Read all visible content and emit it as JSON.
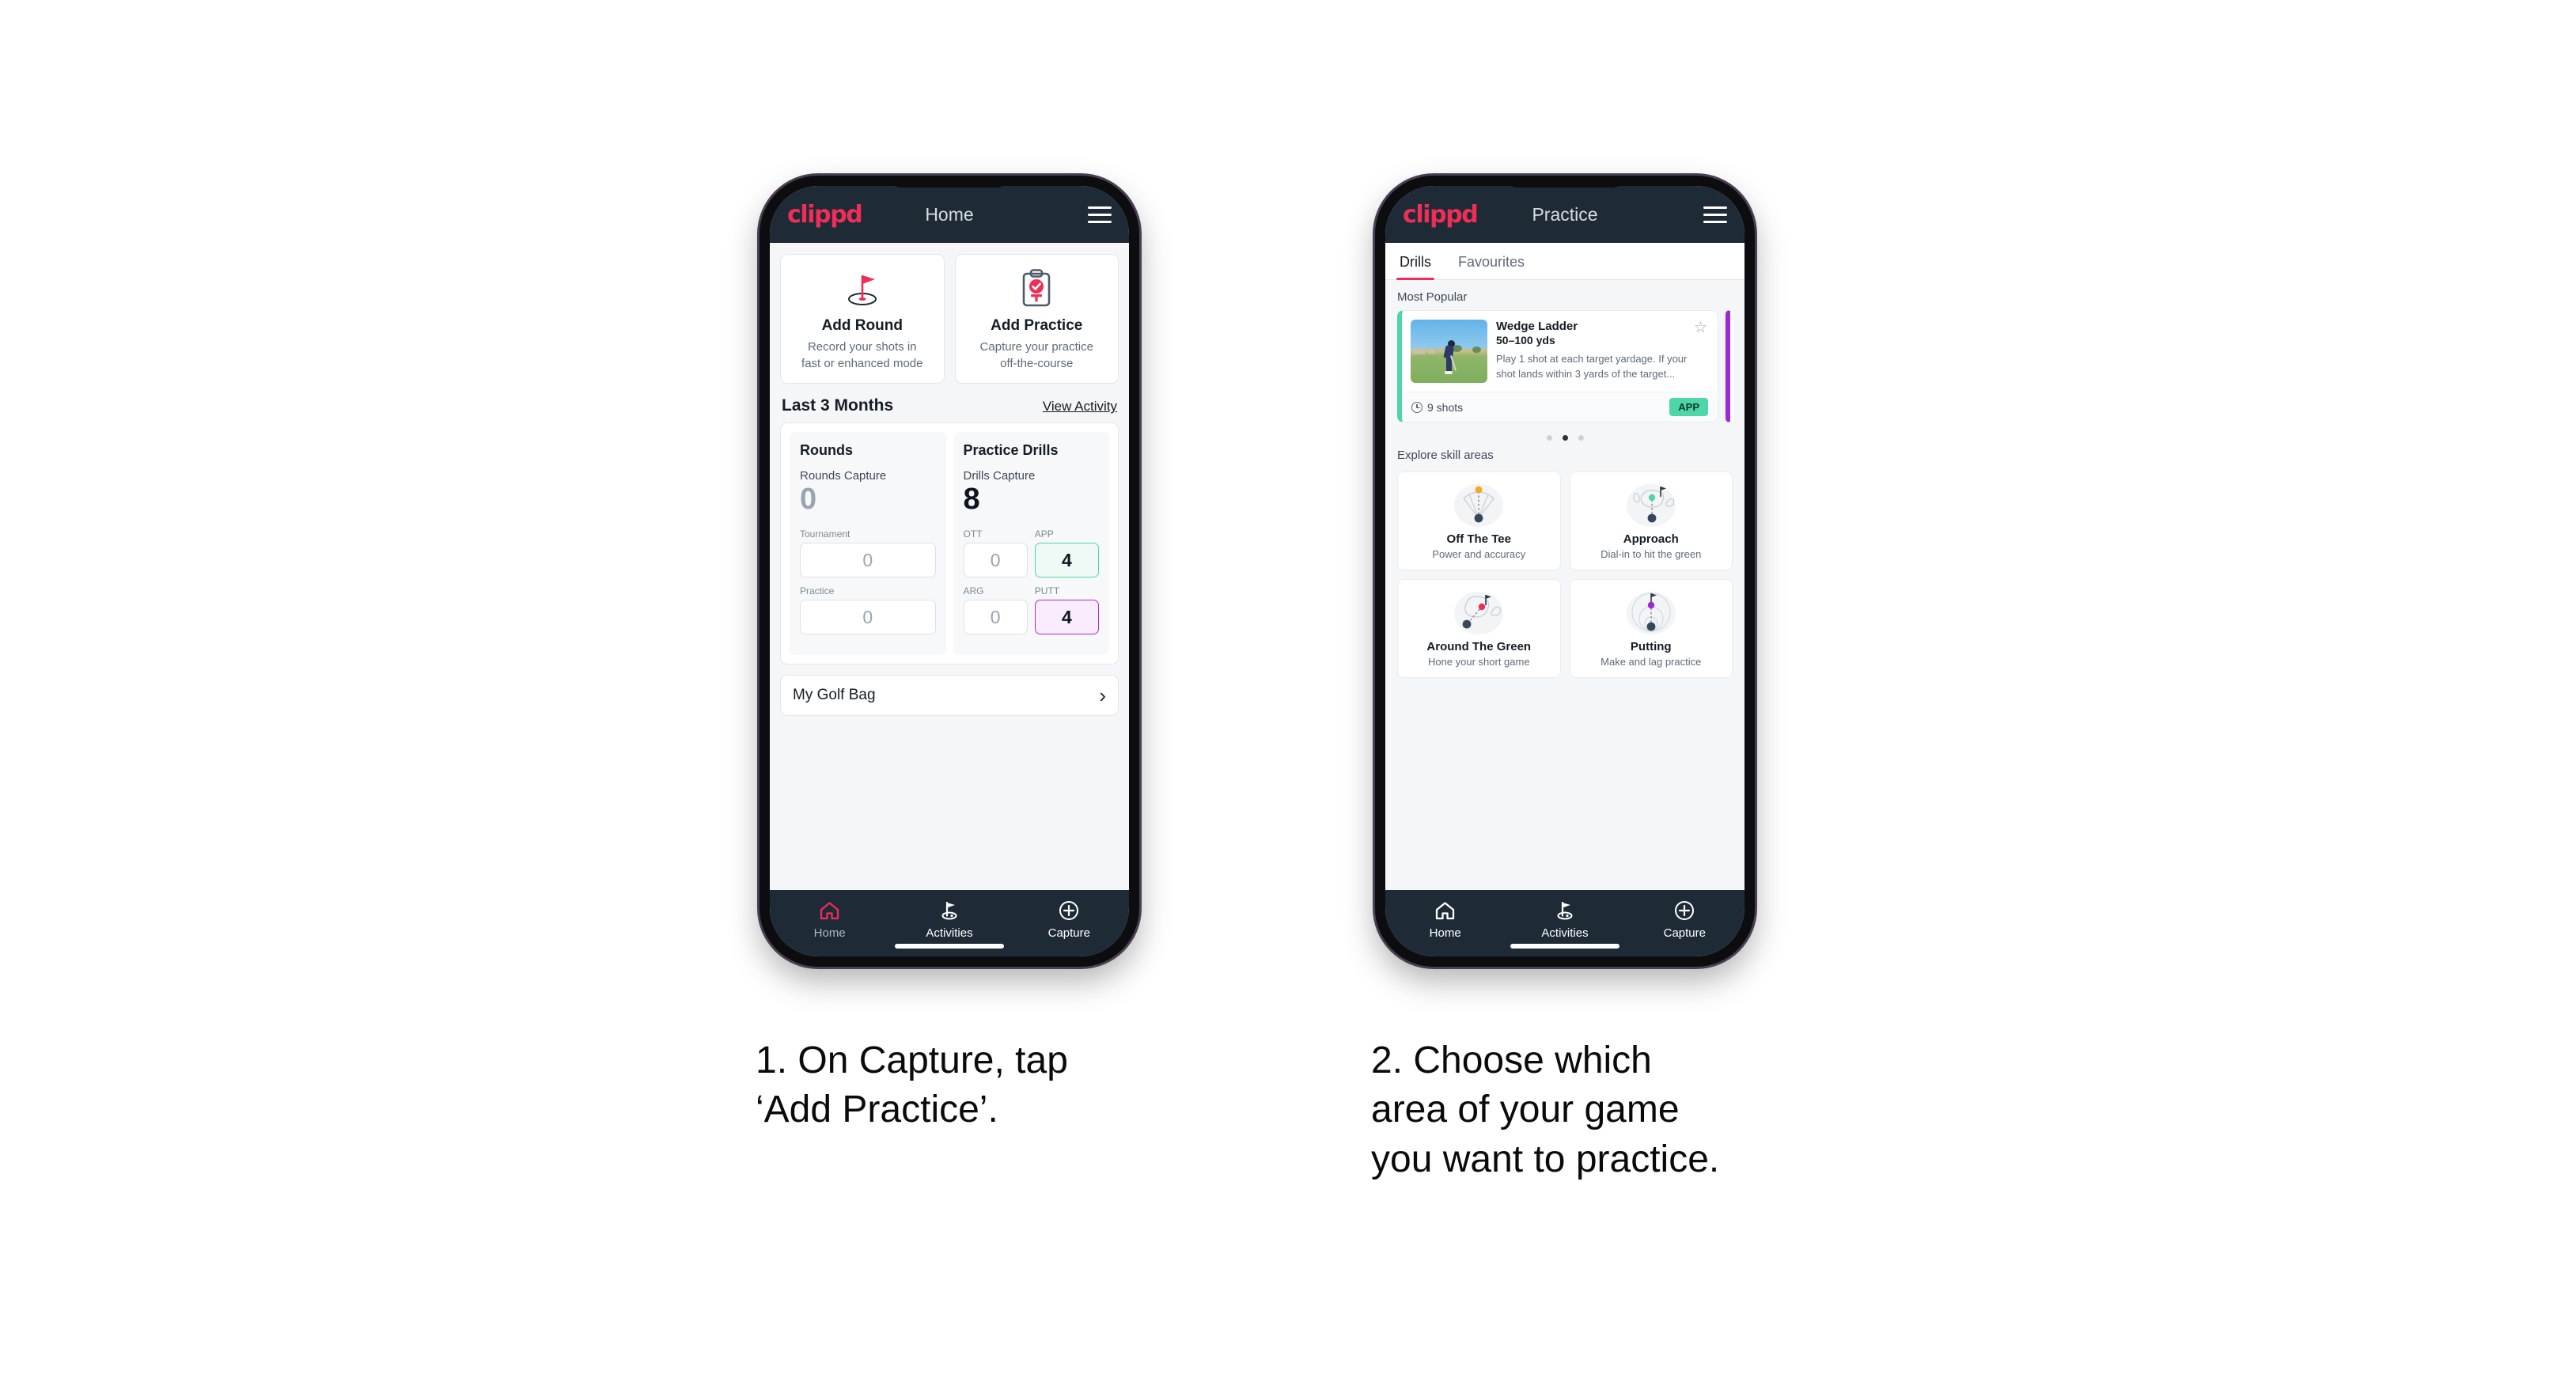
{
  "brand": {
    "logo": "clippd",
    "accent": "#ef2d56",
    "dark": "#1e2b37"
  },
  "phone1": {
    "appbar": {
      "title": "Home",
      "menu_icon": "hamburger-icon"
    },
    "quick_actions": [
      {
        "icon": "golf-flag-hole-icon",
        "title": "Add Round",
        "desc": "Record your shots in\nfast or enhanced mode"
      },
      {
        "icon": "clipboard-check-tee-icon",
        "title": "Add Practice",
        "desc": "Capture your practice\noff-the-course"
      }
    ],
    "section": {
      "title": "Last 3 Months",
      "link": "View Activity"
    },
    "rounds": {
      "title": "Rounds",
      "capture_label": "Rounds Capture",
      "capture_value": "0",
      "fields": [
        {
          "label": "Tournament",
          "value": "0",
          "state": "empty"
        },
        {
          "label": "Practice",
          "value": "0",
          "state": "empty"
        }
      ]
    },
    "drills": {
      "title": "Practice Drills",
      "capture_label": "Drills Capture",
      "capture_value": "8",
      "fields": [
        {
          "label": "OTT",
          "value": "0",
          "state": "empty"
        },
        {
          "label": "APP",
          "value": "4",
          "state": "green"
        },
        {
          "label": "ARG",
          "value": "0",
          "state": "empty"
        },
        {
          "label": "PUTT",
          "value": "4",
          "state": "purple"
        }
      ]
    },
    "golf_bag": {
      "label": "My Golf Bag",
      "chevron": "chevron-right-icon"
    },
    "nav": [
      {
        "icon": "home-icon",
        "label": "Home",
        "active": "true"
      },
      {
        "icon": "golf-flag-icon",
        "label": "Activities",
        "active": "false"
      },
      {
        "icon": "plus-circle-icon",
        "label": "Capture",
        "active": "false"
      }
    ]
  },
  "phone2": {
    "appbar": {
      "title": "Practice",
      "menu_icon": "hamburger-icon"
    },
    "tabs": [
      {
        "label": "Drills",
        "active": "true"
      },
      {
        "label": "Favourites",
        "active": "false"
      }
    ],
    "most_popular_label": "Most Popular",
    "drill": {
      "name": "Wedge Ladder",
      "yardage": "50–100 yds",
      "description": "Play 1 shot at each target yardage. If your shot lands within 3 yards of the target...",
      "shots": "9 shots",
      "tag": "APP",
      "tag_color": "#4ed6a8",
      "accent_color": "#4ed6a8",
      "star_icon": "star-outline-icon",
      "thumb": "golfer-chipping-photo"
    },
    "carousel": {
      "count": 3,
      "active_index": 1
    },
    "explore_label": "Explore skill areas",
    "skills": [
      {
        "art": "off-the-tee-fan-icon",
        "title": "Off The Tee",
        "sub": "Power and accuracy",
        "dot": "#f0ab23"
      },
      {
        "art": "approach-green-icon",
        "title": "Approach",
        "sub": "Dial-in to hit the green",
        "dot": "#4ed6a8"
      },
      {
        "art": "around-the-green-icon",
        "title": "Around The Green",
        "sub": "Hone your short game",
        "dot": "#ef2d56"
      },
      {
        "art": "putting-rings-icon",
        "title": "Putting",
        "sub": "Make and lag practice",
        "dot": "#9e27d6"
      }
    ],
    "nav": [
      {
        "icon": "home-icon",
        "label": "Home",
        "active": "false"
      },
      {
        "icon": "golf-flag-icon",
        "label": "Activities",
        "active": "true"
      },
      {
        "icon": "plus-circle-icon",
        "label": "Capture",
        "active": "false"
      }
    ]
  },
  "captions": {
    "step1": "1. On Capture, tap\n‘Add Practice’.",
    "step2": "2. Choose which\narea of your game\nyou want to practice."
  }
}
